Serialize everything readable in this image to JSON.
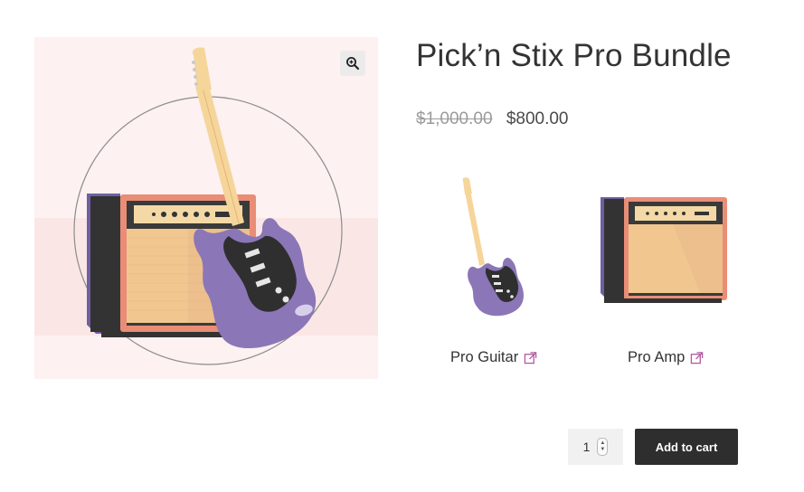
{
  "product": {
    "title": "Pick’n Stix Pro Bundle",
    "price_regular": "$1,000.00",
    "price_sale": "$800.00"
  },
  "bundle": {
    "items": [
      {
        "label": "Pro Guitar",
        "icon": "external-link-icon"
      },
      {
        "label": "Pro Amp",
        "icon": "external-link-icon"
      }
    ]
  },
  "cart": {
    "quantity": "1",
    "add_label": "Add to cart"
  },
  "icons": {
    "zoom": "zoom-in-icon"
  },
  "colors": {
    "guitar_body": "#8b76b7",
    "amp_frame": "#e98d77",
    "button_bg": "#2e2e2e",
    "link_icon": "#b35a9f"
  }
}
